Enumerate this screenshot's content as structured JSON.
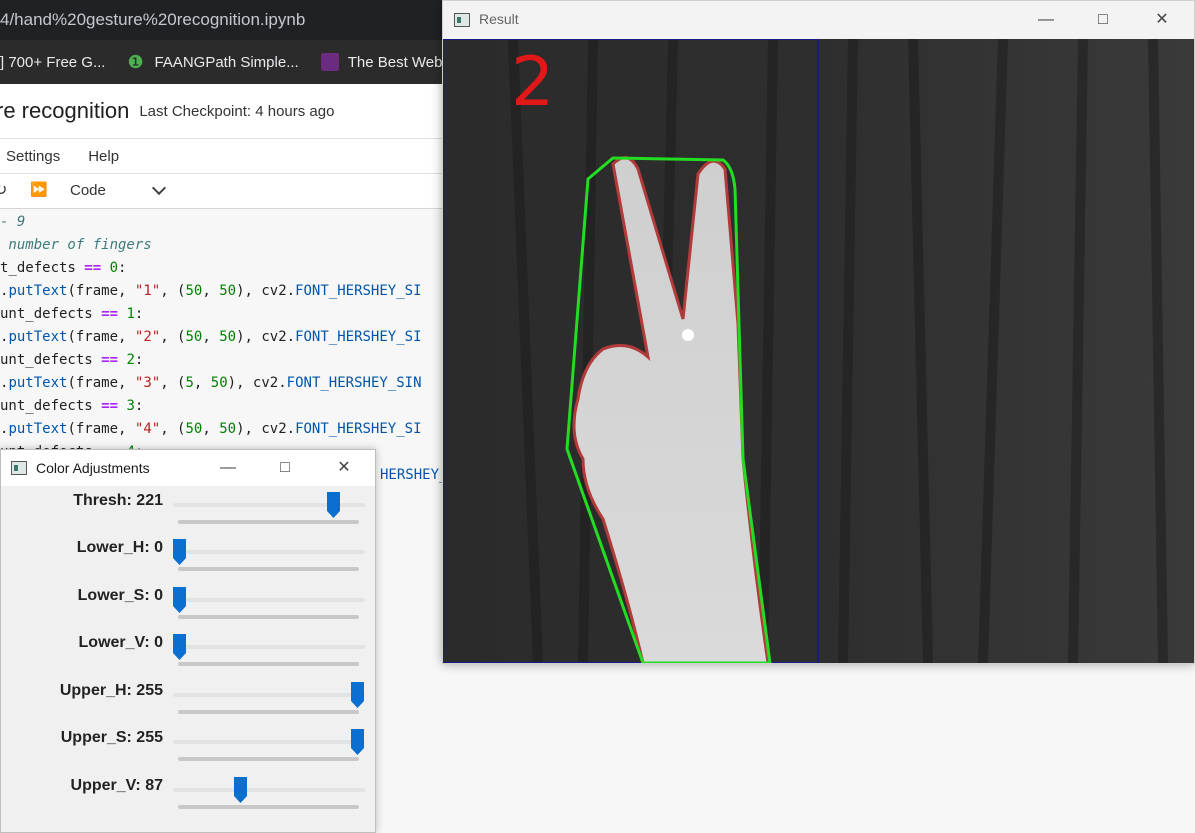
{
  "browser": {
    "url_text": "4/hand%20gesture%20recognition.ipynb",
    "bookmarks": [
      {
        "label": "] 700+ Free G...",
        "icon": "bookmark-icon"
      },
      {
        "label": "FAANGPath Simple...",
        "icon": "leaf-icon"
      },
      {
        "label": "The Best Websit",
        "icon": "site-icon"
      }
    ]
  },
  "jupyter": {
    "notebook_name": "re recognition",
    "checkpoint": "Last Checkpoint: 4 hours ago",
    "menu": [
      "Settings",
      "Help"
    ],
    "cell_type": "Code",
    "code_lines": [
      [
        {
          "t": "- 9",
          "c": "cm"
        }
      ],
      [
        {
          "t": " number of fingers",
          "c": "cm"
        }
      ],
      [
        {
          "t": "t_defects ",
          "c": ""
        },
        {
          "t": "==",
          "c": "kw"
        },
        {
          "t": " ",
          "c": ""
        },
        {
          "t": "0",
          "c": "num"
        },
        {
          "t": ":",
          "c": ""
        }
      ],
      [
        {
          "t": ".",
          "c": ""
        },
        {
          "t": "putText",
          "c": "mod"
        },
        {
          "t": "(frame, ",
          "c": ""
        },
        {
          "t": "\"1\"",
          "c": "str"
        },
        {
          "t": ", (",
          "c": ""
        },
        {
          "t": "50",
          "c": "num"
        },
        {
          "t": ", ",
          "c": ""
        },
        {
          "t": "50",
          "c": "num"
        },
        {
          "t": "), cv2.",
          "c": ""
        },
        {
          "t": "FONT_HERSHEY_SI",
          "c": "mod"
        }
      ],
      [
        {
          "t": "unt_defects ",
          "c": ""
        },
        {
          "t": "==",
          "c": "kw"
        },
        {
          "t": " ",
          "c": ""
        },
        {
          "t": "1",
          "c": "num"
        },
        {
          "t": ":",
          "c": ""
        }
      ],
      [
        {
          "t": ".",
          "c": ""
        },
        {
          "t": "putText",
          "c": "mod"
        },
        {
          "t": "(frame, ",
          "c": ""
        },
        {
          "t": "\"2\"",
          "c": "str"
        },
        {
          "t": ", (",
          "c": ""
        },
        {
          "t": "50",
          "c": "num"
        },
        {
          "t": ", ",
          "c": ""
        },
        {
          "t": "50",
          "c": "num"
        },
        {
          "t": "), cv2.",
          "c": ""
        },
        {
          "t": "FONT_HERSHEY_SI",
          "c": "mod"
        }
      ],
      [
        {
          "t": "unt_defects ",
          "c": ""
        },
        {
          "t": "==",
          "c": "kw"
        },
        {
          "t": " ",
          "c": ""
        },
        {
          "t": "2",
          "c": "num"
        },
        {
          "t": ":",
          "c": ""
        }
      ],
      [
        {
          "t": ".",
          "c": ""
        },
        {
          "t": "putText",
          "c": "mod"
        },
        {
          "t": "(frame, ",
          "c": ""
        },
        {
          "t": "\"3\"",
          "c": "str"
        },
        {
          "t": ", (",
          "c": ""
        },
        {
          "t": "5",
          "c": "num"
        },
        {
          "t": ", ",
          "c": ""
        },
        {
          "t": "50",
          "c": "num"
        },
        {
          "t": "), cv2.",
          "c": ""
        },
        {
          "t": "FONT_HERSHEY_SIN",
          "c": "mod"
        }
      ],
      [
        {
          "t": "unt_defects ",
          "c": ""
        },
        {
          "t": "==",
          "c": "kw"
        },
        {
          "t": " ",
          "c": ""
        },
        {
          "t": "3",
          "c": "num"
        },
        {
          "t": ":",
          "c": ""
        }
      ],
      [
        {
          "t": ".",
          "c": ""
        },
        {
          "t": "putText",
          "c": "mod"
        },
        {
          "t": "(frame, ",
          "c": ""
        },
        {
          "t": "\"4\"",
          "c": "str"
        },
        {
          "t": ", (",
          "c": ""
        },
        {
          "t": "50",
          "c": "num"
        },
        {
          "t": ", ",
          "c": ""
        },
        {
          "t": "50",
          "c": "num"
        },
        {
          "t": "), cv2.",
          "c": ""
        },
        {
          "t": "FONT_HERSHEY_SI",
          "c": "mod"
        }
      ],
      [
        {
          "t": "unt_defects ",
          "c": ""
        },
        {
          "t": "==",
          "c": "kw"
        },
        {
          "t": " ",
          "c": ""
        },
        {
          "t": "4",
          "c": "num"
        },
        {
          "t": ":",
          "c": ""
        }
      ],
      [
        {
          "t": "HERSHEY_SI",
          "c": "mod"
        }
      ]
    ]
  },
  "result_window": {
    "title": "Result",
    "finger_count": "2",
    "colors": {
      "contour": "#b23a3a",
      "hull": "#22dd22",
      "count_text": "#e01818",
      "roi_line": "#1a1a8c"
    }
  },
  "adjust_window": {
    "title": "Color Adjustments",
    "thumb_color": "#0a6fd1",
    "trackbars": [
      {
        "name": "Thresh",
        "value": 221,
        "max": 255
      },
      {
        "name": "Lower_H",
        "value": 0,
        "max": 255
      },
      {
        "name": "Lower_S",
        "value": 0,
        "max": 255
      },
      {
        "name": "Lower_V",
        "value": 0,
        "max": 255
      },
      {
        "name": "Upper_H",
        "value": 255,
        "max": 255
      },
      {
        "name": "Upper_S",
        "value": 255,
        "max": 255
      },
      {
        "name": "Upper_V",
        "value": 87,
        "max": 255
      }
    ]
  }
}
